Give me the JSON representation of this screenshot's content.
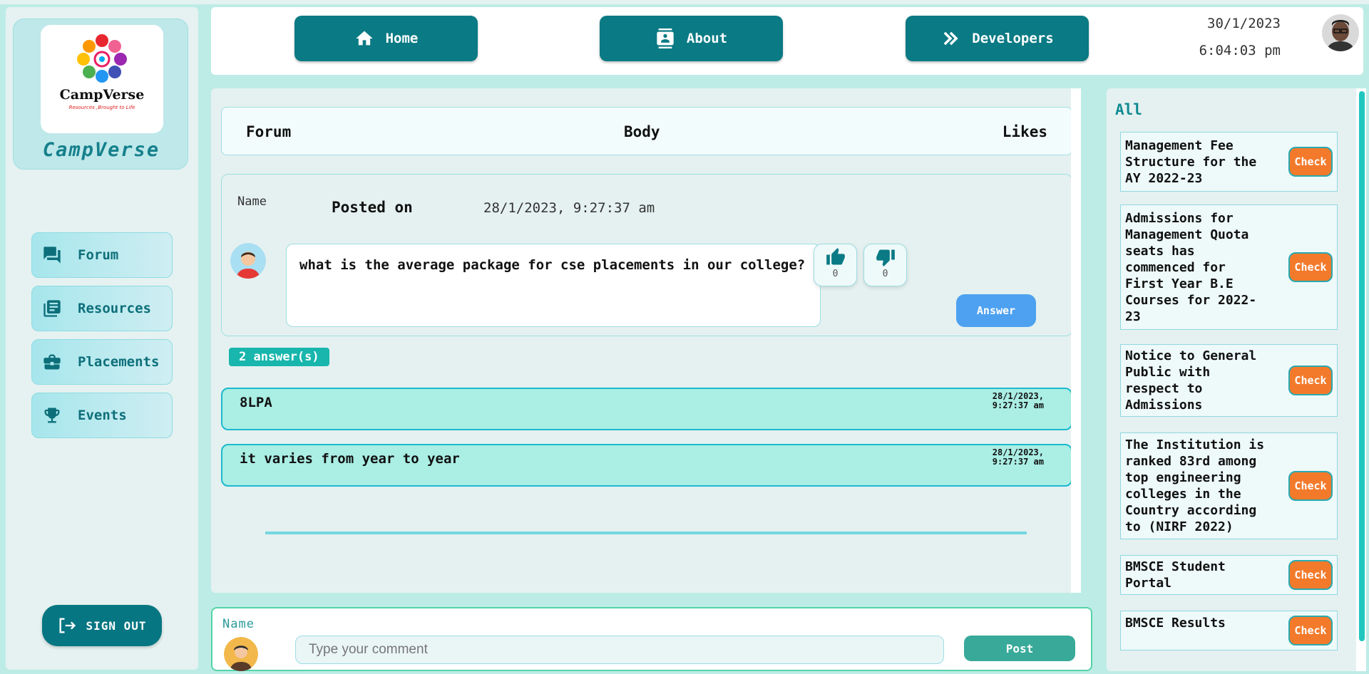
{
  "brand": {
    "name": "CampVerse",
    "logo_text": "CampVerse",
    "logo_tagline": "Resources ,Brought to Life"
  },
  "nav": [
    {
      "label": "Forum",
      "icon": "forum-icon"
    },
    {
      "label": "Resources",
      "icon": "library-books-icon"
    },
    {
      "label": "Placements",
      "icon": "briefcase-icon"
    },
    {
      "label": "Events",
      "icon": "trophy-icon"
    }
  ],
  "signout_label": "SIGN OUT",
  "header": {
    "buttons": [
      {
        "label": "Home",
        "icon": "home-icon"
      },
      {
        "label": "About",
        "icon": "contact-card-icon"
      },
      {
        "label": "Developers",
        "icon": "double-chevron-right-icon"
      }
    ],
    "date": "30/1/2023",
    "time": "6:04:03 pm"
  },
  "forum": {
    "columns": [
      "Forum",
      "Body",
      "Likes"
    ],
    "post": {
      "name_label": "Name",
      "posted_label": "Posted on",
      "posted_date": "28/1/2023, 9:27:37 am",
      "body": "what is the average package for cse placements in our college?",
      "likes": "0",
      "dislikes": "0",
      "answer_label": "Answer"
    },
    "answers_count_label": "2 answer(s)",
    "answers": [
      {
        "text": "8LPA",
        "date_line1": "28/1/2023,",
        "date_line2": "9:27:37 am"
      },
      {
        "text": "it varies from year to year",
        "date_line1": "28/1/2023,",
        "date_line2": "9:27:37 am"
      }
    ]
  },
  "comment": {
    "name_label": "Name",
    "placeholder": "Type your comment",
    "value": "",
    "post_label": "Post"
  },
  "notices": {
    "heading": "All",
    "check_label": "Check",
    "items": [
      "Management Fee Structure for the AY 2022-23",
      "Admissions for Management Quota seats has commenced for First Year B.E Courses for 2022-23",
      "Notice to General Public with respect to Admissions",
      "The Institution is ranked 83rd among top engineering colleges in the Country according to (NIRF 2022)",
      "BMSCE Student Portal",
      "BMSCE Results"
    ]
  },
  "colors": {
    "background": "#bdece6",
    "primary_teal": "#0a7a84",
    "answer_blue": "#4ea1f0",
    "check_orange": "#f37a2b",
    "answer_bg": "#aaeee4"
  }
}
